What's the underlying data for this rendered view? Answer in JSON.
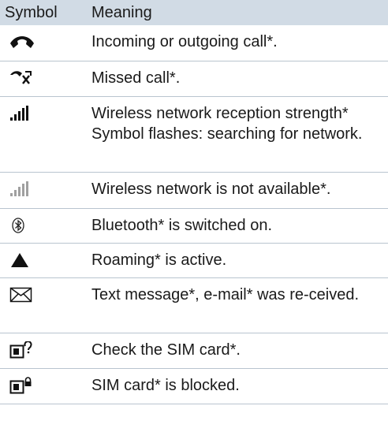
{
  "header": {
    "symbol": "Symbol",
    "meaning": "Meaning"
  },
  "rows": [
    {
      "icon": "phone-call-icon",
      "meaning": "Incoming or outgoing call*."
    },
    {
      "icon": "missed-call-icon",
      "meaning": "Missed call*."
    },
    {
      "icon": "signal-strength-icon",
      "meaning": "Wireless network reception strength* Symbol flashes: searching for network."
    },
    {
      "icon": "signal-unavailable-icon",
      "meaning": "Wireless network is not available*."
    },
    {
      "icon": "bluetooth-icon",
      "meaning": "Bluetooth* is switched on."
    },
    {
      "icon": "roaming-triangle-icon",
      "meaning": "Roaming* is active."
    },
    {
      "icon": "envelope-icon",
      "meaning": "Text message*, e-mail* was re-ceived."
    },
    {
      "icon": "sim-check-icon",
      "meaning": "Check the SIM card*."
    },
    {
      "icon": "sim-blocked-icon",
      "meaning": "SIM card* is blocked."
    }
  ]
}
